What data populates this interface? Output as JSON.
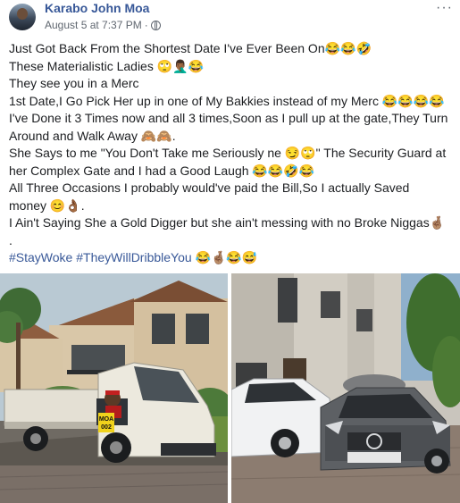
{
  "post": {
    "author": "Karabo John Moa",
    "timestamp": "August 5 at 7:37 PM",
    "dot": "·",
    "privacy_icon": "globe-icon",
    "more_icon": "more-options-icon",
    "more_label": "···"
  },
  "text_lines": [
    "Just Got Back From the Shortest Date I've Ever Been On😂😂🤣",
    "These Materialistic Ladies 🙄🤦🏾‍♂️😂",
    "They see you in a Merc",
    "1st Date,I Go Pick Her up in one of My Bakkies instead of my Merc 😂😂😂😂",
    "I've Done it 3 Times now and all 3 times,Soon as I pull up at the gate,They Turn",
    "Around and Walk Away 🙈🙈.",
    "She Says to me \"You Don't Take me Seriously ne 😏🙄\" The Security Guard at",
    "her Complex Gate and I had a Good Laugh 😂😂🤣😂",
    "All Three Occasions I probably would've paid the Bill,So I actually Saved",
    "money 😊👌🏾.",
    "I Ain't Saying She a Gold Digger but she ain't messing with no Broke Niggas🤞🏽",
    "."
  ],
  "hashtags": {
    "tag1": "#StayWoke",
    "tag2": "#TheyWillDribbleYou",
    "emojis": " 😂🤞🏽😂😅"
  },
  "photos": {
    "left": {
      "truck_plate_line1": "MOA",
      "truck_plate_line2": "002"
    }
  }
}
